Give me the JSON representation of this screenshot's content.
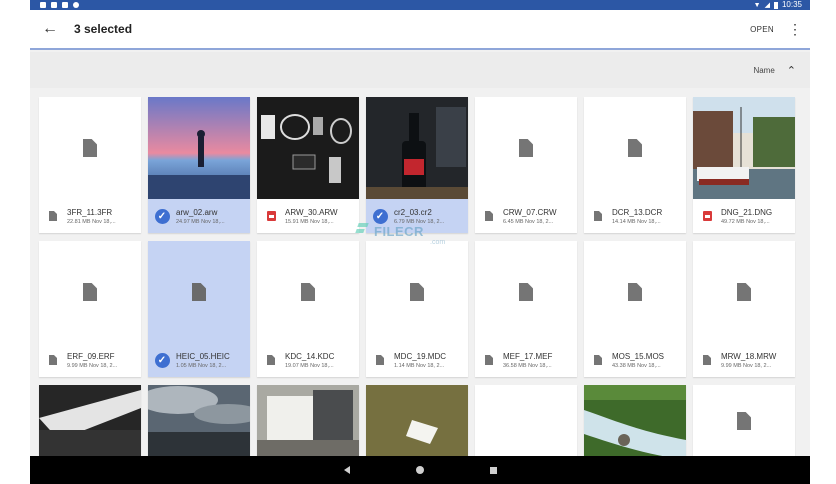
{
  "status": {
    "time": "10:35"
  },
  "appbar": {
    "title": "3 selected",
    "open_label": "OPEN",
    "back_icon": "arrow-left-icon",
    "more_icon": "more-vert-icon"
  },
  "sort": {
    "label": "Name",
    "direction_icon": "chevron-up-icon"
  },
  "watermark": {
    "brand": "FILECR",
    "domain": ".com"
  },
  "files": [
    {
      "name": "3FR_11.3FR",
      "info": "22.81 MB Nov 18,...",
      "selected": false,
      "thumb": "doc",
      "type_icon": "doc"
    },
    {
      "name": "arw_02.arw",
      "info": "24.97 MB Nov 18,...",
      "selected": true,
      "thumb": "sunset",
      "type_icon": "check"
    },
    {
      "name": "ARW_30.ARW",
      "info": "15.91 MB Nov 18,...",
      "selected": false,
      "thumb": "desk",
      "type_icon": "image"
    },
    {
      "name": "cr2_03.cr2",
      "info": "6.79 MB Nov 18, 2...",
      "selected": true,
      "thumb": "bottle",
      "type_icon": "check"
    },
    {
      "name": "CRW_07.CRW",
      "info": "6.45 MB Nov 18, 2...",
      "selected": false,
      "thumb": "doc",
      "type_icon": "doc"
    },
    {
      "name": "DCR_13.DCR",
      "info": "14.14 MB Nov 18,...",
      "selected": false,
      "thumb": "doc",
      "type_icon": "doc"
    },
    {
      "name": "DNG_21.DNG",
      "info": "49.72 MB Nov 18,...",
      "selected": false,
      "thumb": "canal",
      "type_icon": "image"
    },
    {
      "name": "ERF_09.ERF",
      "info": "9.99 MB Nov 18, 2...",
      "selected": false,
      "thumb": "doc",
      "type_icon": "doc"
    },
    {
      "name": "HEIC_05.HEIC",
      "info": "1.05 MB Nov 18, 2...",
      "selected": true,
      "thumb": "doc",
      "type_icon": "check"
    },
    {
      "name": "KDC_14.KDC",
      "info": "19.07 MB Nov 18,...",
      "selected": false,
      "thumb": "doc",
      "type_icon": "doc"
    },
    {
      "name": "MDC_19.MDC",
      "info": "1.14 MB Nov 18, 2...",
      "selected": false,
      "thumb": "doc",
      "type_icon": "doc"
    },
    {
      "name": "MEF_17.MEF",
      "info": "36.58 MB Nov 18,...",
      "selected": false,
      "thumb": "doc",
      "type_icon": "doc"
    },
    {
      "name": "MOS_15.MOS",
      "info": "43.38 MB Nov 18,...",
      "selected": false,
      "thumb": "doc",
      "type_icon": "doc"
    },
    {
      "name": "MRW_18.MRW",
      "info": "9.99 MB Nov 18, 2...",
      "selected": false,
      "thumb": "doc",
      "type_icon": "doc"
    },
    {
      "name": "",
      "info": "",
      "selected": false,
      "thumb": "dark-light",
      "type_icon": ""
    },
    {
      "name": "",
      "info": "",
      "selected": false,
      "thumb": "clouds",
      "type_icon": ""
    },
    {
      "name": "",
      "info": "",
      "selected": false,
      "thumb": "machine",
      "type_icon": ""
    },
    {
      "name": "",
      "info": "",
      "selected": false,
      "thumb": "grass",
      "type_icon": ""
    },
    {
      "name": "",
      "info": "",
      "selected": false,
      "thumb": "blank",
      "type_icon": ""
    },
    {
      "name": "",
      "info": "",
      "selected": false,
      "thumb": "stream",
      "type_icon": ""
    },
    {
      "name": "",
      "info": "",
      "selected": false,
      "thumb": "doc",
      "type_icon": ""
    }
  ]
}
